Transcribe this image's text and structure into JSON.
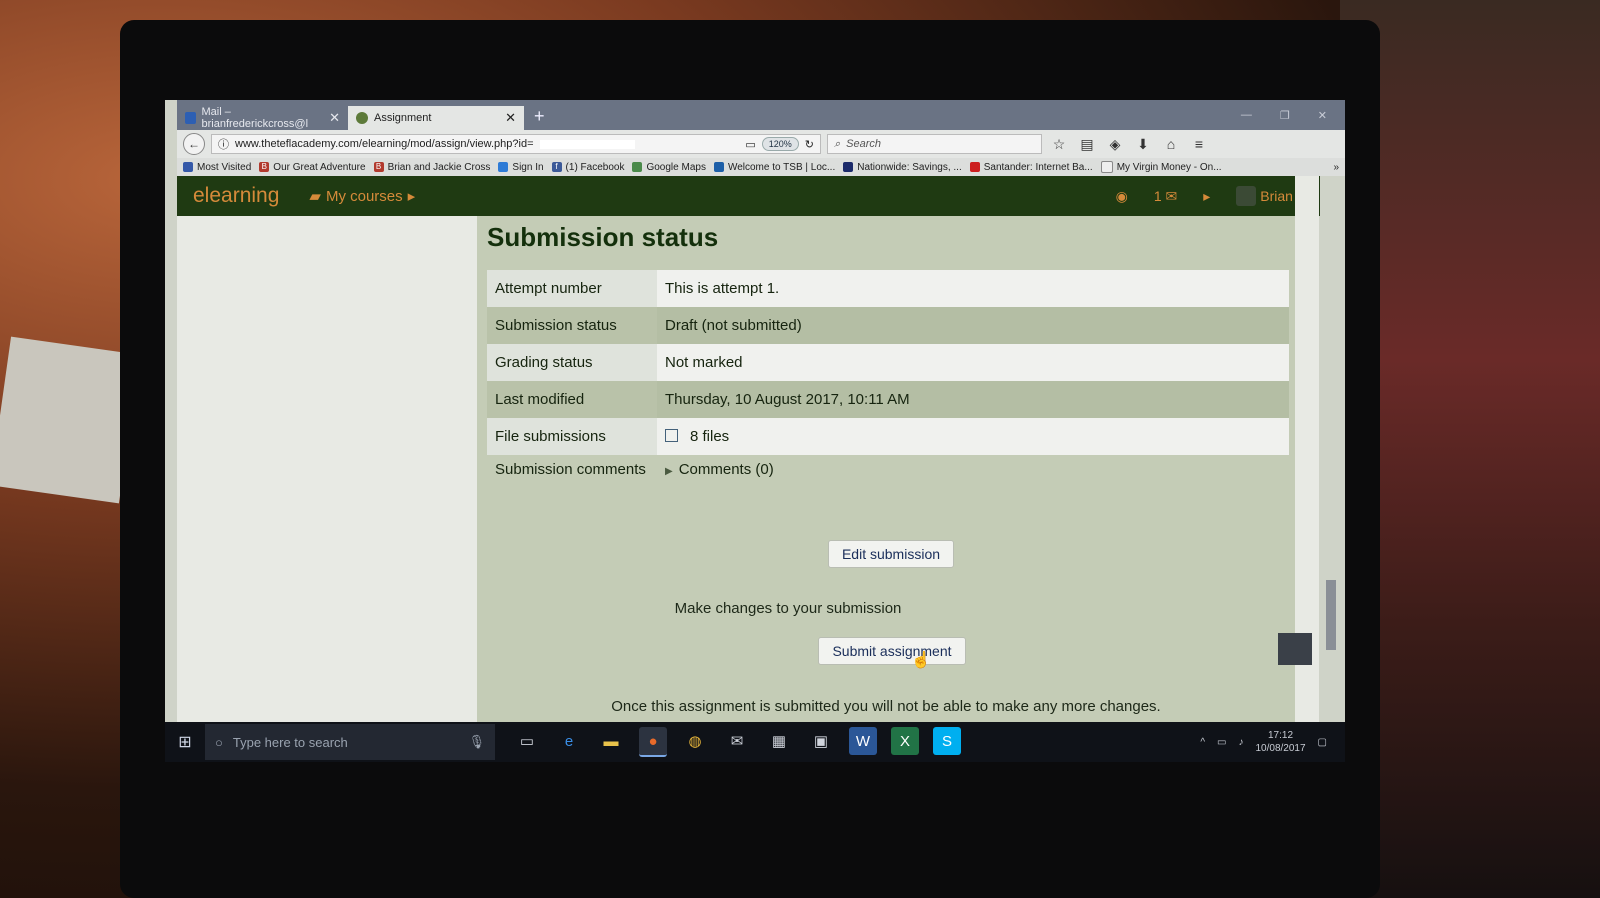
{
  "browser": {
    "tabs": [
      {
        "label": "Mail – brianfrederickcross@l",
        "active": false
      },
      {
        "label": "Assignment",
        "active": true
      }
    ],
    "url": "www.theteflacademy.com/elearning/mod/assign/view.php?id=",
    "zoom": "120%",
    "search_placeholder": "Search",
    "bookmarks": [
      "Most Visited",
      "Our Great Adventure",
      "Brian and Jackie Cross",
      "Sign In",
      "(1) Facebook",
      "Google Maps",
      "Welcome to TSB | Loc...",
      "Nationwide: Savings, ...",
      "Santander: Internet Ba...",
      "My Virgin Money - On..."
    ]
  },
  "header": {
    "brand": "elearning",
    "my_courses": "My courses",
    "message_count": "1",
    "user": "Brian"
  },
  "main": {
    "title": "Submission status",
    "rows": [
      {
        "label": "Attempt number",
        "value": "This is attempt 1."
      },
      {
        "label": "Submission status",
        "value": "Draft (not submitted)"
      },
      {
        "label": "Grading status",
        "value": "Not marked"
      },
      {
        "label": "Last modified",
        "value": "Thursday, 10 August 2017, 10:11 AM"
      },
      {
        "label": "File submissions",
        "value": "8 files"
      },
      {
        "label": "Submission comments",
        "value": "Comments (0)"
      }
    ],
    "edit_button": "Edit submission",
    "help_text": "Make changes to your submission",
    "submit_button": "Submit assignment",
    "warning": "Once this assignment is submitted you will not be able to make any more changes."
  },
  "taskbar": {
    "search_placeholder": "Type here to search",
    "time": "17:12",
    "date": "10/08/2017"
  }
}
